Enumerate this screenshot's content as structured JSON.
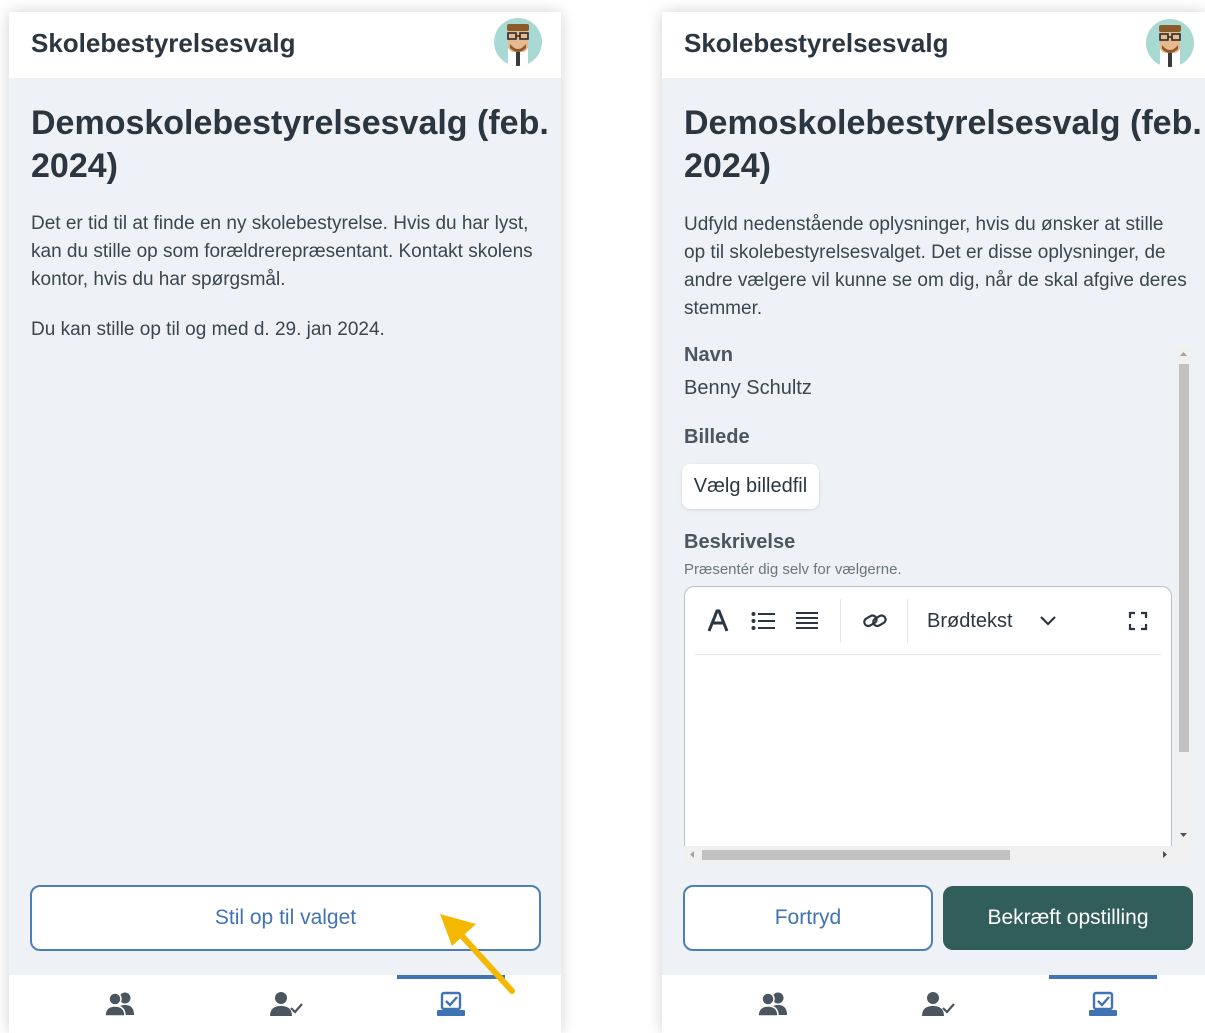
{
  "app": {
    "title": "Skolebestyrelsesvalg"
  },
  "election": {
    "title": "Demoskolebestyrelsesvalg (feb. 2024)"
  },
  "left_screen": {
    "intro": "Det er tid til at finde en ny skolebestyrelse. Hvis du har lyst, kan du stille op som forældrerepræsentant. Kontakt skolens kontor, hvis du har spørgsmål.",
    "deadline": "Du kan stille op til og med d. 29. jan 2024.",
    "run_button": "Stil op til valget"
  },
  "right_screen": {
    "intro": "Udfyld nedenstående oplysninger, hvis du ønsker at stille op til skolebestyrelsesvalget. Det er disse oplysninger, de andre vælgere vil kunne se om dig, når de skal afgive deres stemmer.",
    "name_label": "Navn",
    "name_value": "Benny Schultz",
    "image_label": "Billede",
    "image_button": "Vælg billedfil",
    "description_label": "Beskrivelse",
    "description_hint": "Præsentér dig selv for vælgerne.",
    "text_style": "Brødtekst",
    "cancel_button": "Fortryd",
    "confirm_button": "Bekræft opstilling"
  },
  "nav": {
    "active_index": 2,
    "icons": [
      "people-icon",
      "person-check-icon",
      "ballot-check-icon"
    ]
  },
  "colors": {
    "accent": "#3f73b3",
    "primary_button": "#315d5a",
    "background": "#eef1f5",
    "annotation_arrow": "#f5b800"
  }
}
